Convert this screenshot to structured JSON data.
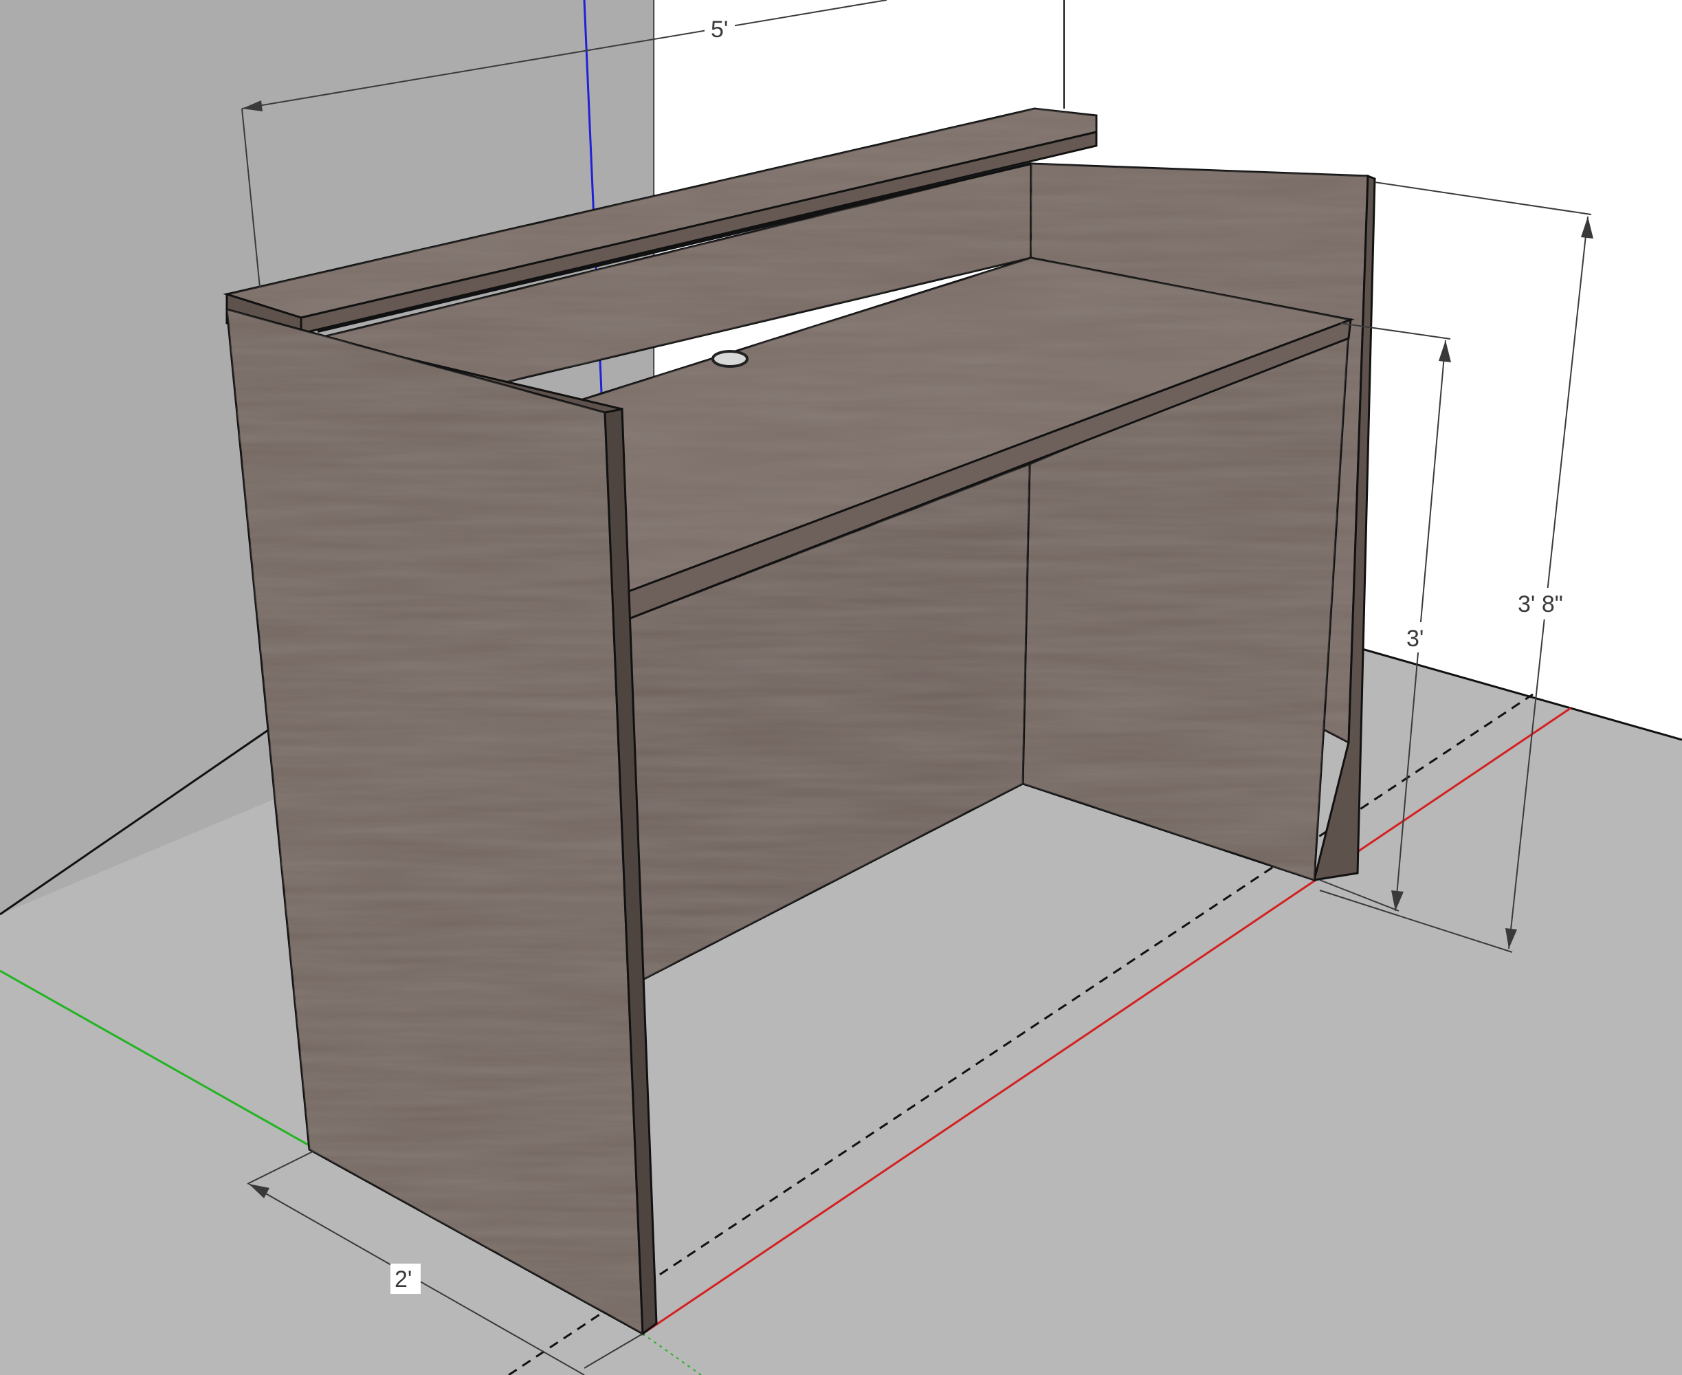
{
  "dimensions": {
    "width_label": "5'",
    "depth_label": "2'",
    "desk_height_label": "3'",
    "total_height_label": "3' 8\""
  },
  "colors": {
    "ground": "#b8b8b8",
    "left_wall": "#acacac",
    "back_wall": "#ffffff",
    "wood_light": "#7a6c66",
    "wood_mid": "#6e615b",
    "wood_dark": "#5e524d",
    "wood_grain": "#4b403c",
    "outline": "#111111",
    "axis_red": "#d42020",
    "axis_green": "#22b422",
    "axis_blue": "#2020d8",
    "dim_line": "#3a3a3a"
  }
}
